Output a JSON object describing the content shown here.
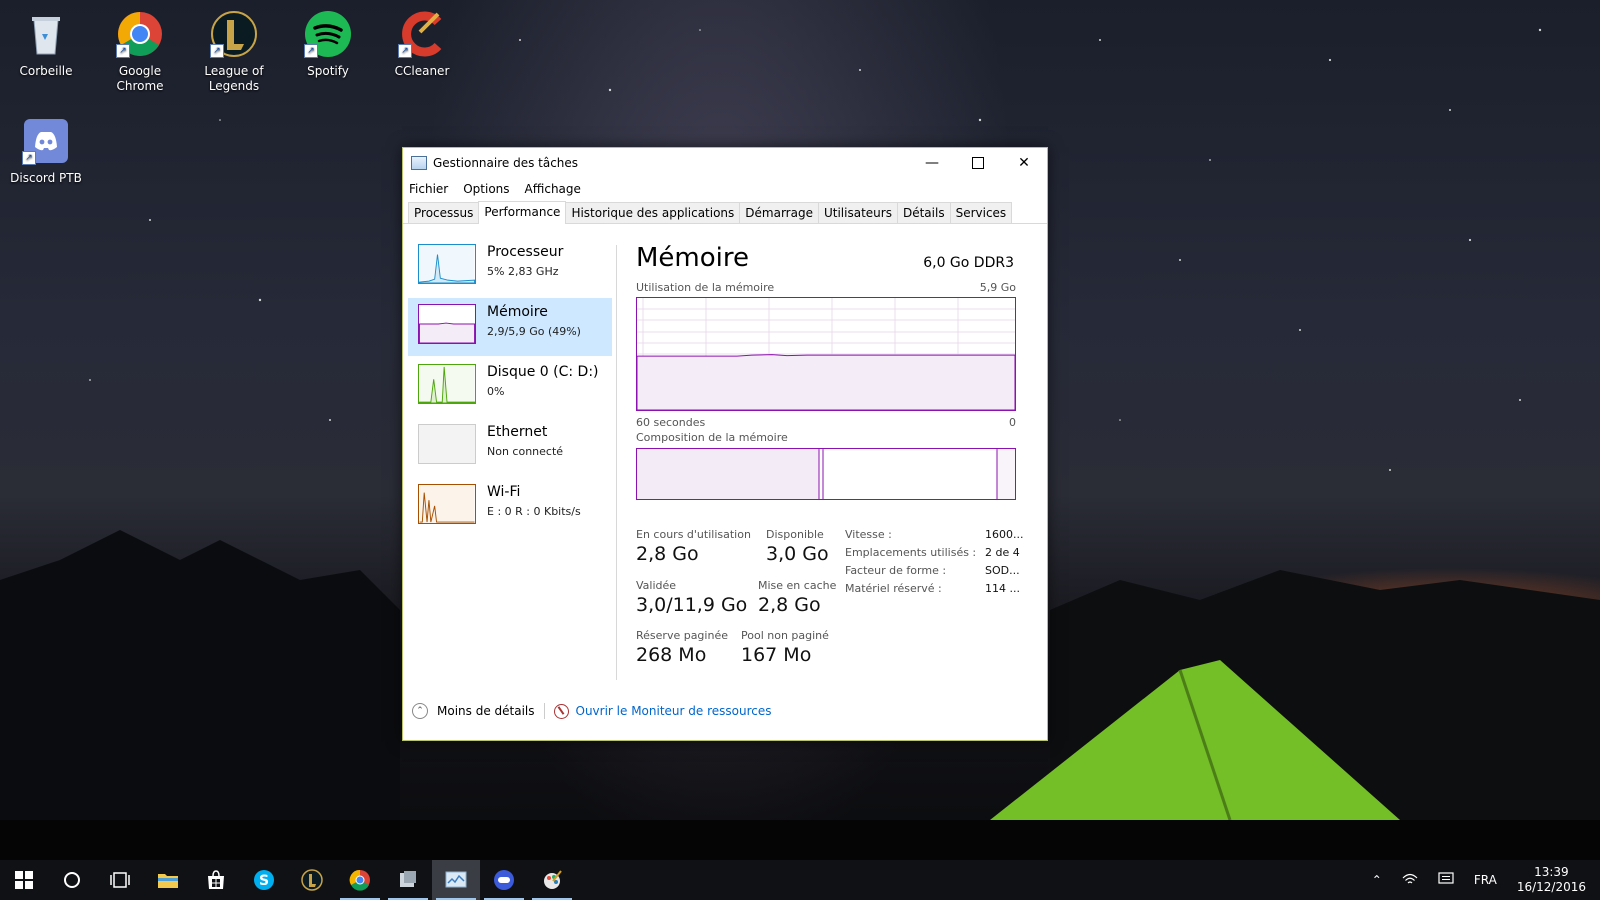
{
  "desktop": {
    "icons": [
      {
        "label": "Corbeille"
      },
      {
        "label": "Google Chrome"
      },
      {
        "label": "League of Legends"
      },
      {
        "label": "Spotify"
      },
      {
        "label": "CCleaner"
      },
      {
        "label": "Discord PTB"
      }
    ]
  },
  "window": {
    "title": "Gestionnaire des tâches",
    "menu": [
      "Fichier",
      "Options",
      "Affichage"
    ],
    "tabs": [
      "Processus",
      "Performance",
      "Historique des applications",
      "Démarrage",
      "Utilisateurs",
      "Détails",
      "Services"
    ],
    "active_tab": "Performance",
    "sidebar": [
      {
        "name": "Processeur",
        "sub": "5% 2,83 GHz",
        "color": "#1b8fcc"
      },
      {
        "name": "Mémoire",
        "sub": "2,9/5,9 Go (49%)",
        "color": "#8b12ae"
      },
      {
        "name": "Disque 0 (C: D:)",
        "sub": "0%",
        "color": "#4da60c"
      },
      {
        "name": "Ethernet",
        "sub": "Non connecté",
        "color": "#cccccc"
      },
      {
        "name": "Wi-Fi",
        "sub": "E : 0 R : 0 Kbits/s",
        "color": "#a74f01"
      }
    ],
    "main": {
      "title": "Mémoire",
      "spec": "6,0 Go DDR3",
      "usage_label": "Utilisation de la mémoire",
      "usage_max": "5,9 Go",
      "time_left": "60 secondes",
      "time_right": "0",
      "composition_label": "Composition de la mémoire",
      "usage_fraction": 0.49,
      "stats": {
        "in_use_label": "En cours d'utilisation",
        "in_use": "2,8 Go",
        "available_label": "Disponible",
        "available": "3,0 Go",
        "committed_label": "Validée",
        "committed": "3,0/11,9 Go",
        "cached_label": "Mise en cache",
        "cached": "2,8 Go",
        "paged_label": "Réserve paginée",
        "paged": "268 Mo",
        "nonpaged_label": "Pool non paginé",
        "nonpaged": "167 Mo"
      },
      "details": [
        {
          "key": "Vitesse :",
          "value": "1600..."
        },
        {
          "key": "Emplacements utilisés :",
          "value": "2 de 4"
        },
        {
          "key": "Facteur de forme :",
          "value": "SOD..."
        },
        {
          "key": "Matériel réservé :",
          "value": "114 ..."
        }
      ]
    },
    "footer": {
      "less_details": "Moins de détails",
      "open_monitor": "Ouvrir le Moniteur de ressources"
    }
  },
  "taskbar": {
    "language": "FRA",
    "time": "13:39",
    "date": "16/12/2016"
  }
}
